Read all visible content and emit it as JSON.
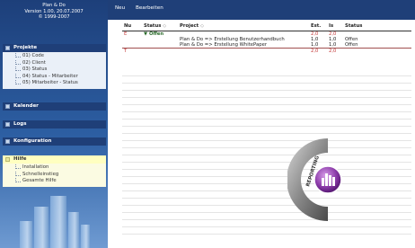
{
  "brand": {
    "title": "Plan & Do",
    "version": "Version 1.00, 20.07.2007",
    "copyright": "© 1999-2007"
  },
  "sidebar": {
    "projekte": {
      "label": "Projekte",
      "items": [
        "01) Code",
        "02) Client",
        "03) Status",
        "04) Status - Mitarbeiter",
        "05) Mitarbeiter - Status"
      ]
    },
    "kalender": {
      "label": "Kalender"
    },
    "logs": {
      "label": "Logs"
    },
    "konfiguration": {
      "label": "Konfiguration"
    },
    "hilfe": {
      "label": "Hilfe",
      "items": [
        "Installation",
        "Schnelleinstieg",
        "Gesamte Hilfe"
      ]
    }
  },
  "menubar": {
    "neu": "Neu",
    "bearbeiten": "Bearbeiten"
  },
  "table": {
    "headers": {
      "nu": "Nu",
      "status": "Status",
      "project": "Project",
      "est": "Est.",
      "is": "Is",
      "status2": "Status"
    },
    "sort_glyph": "◇",
    "group": {
      "marker": "E",
      "arrow": "▼",
      "label": "Offen",
      "est": "2,0",
      "is": "2,0"
    },
    "rows": [
      {
        "project": "Plan & Do => Erstellung Benutzerhandbuch",
        "est": "1,0",
        "is": "1,0",
        "status": "Offen"
      },
      {
        "project": "Plan & Do => Erstellung WhitePaper",
        "est": "1,0",
        "is": "1,0",
        "status": "Offen"
      }
    ],
    "total": {
      "marker": "T",
      "est": "2,0",
      "is": "2,0"
    }
  },
  "logo": {
    "text": "REPORTING",
    "icon": "bar-chart-icon"
  }
}
